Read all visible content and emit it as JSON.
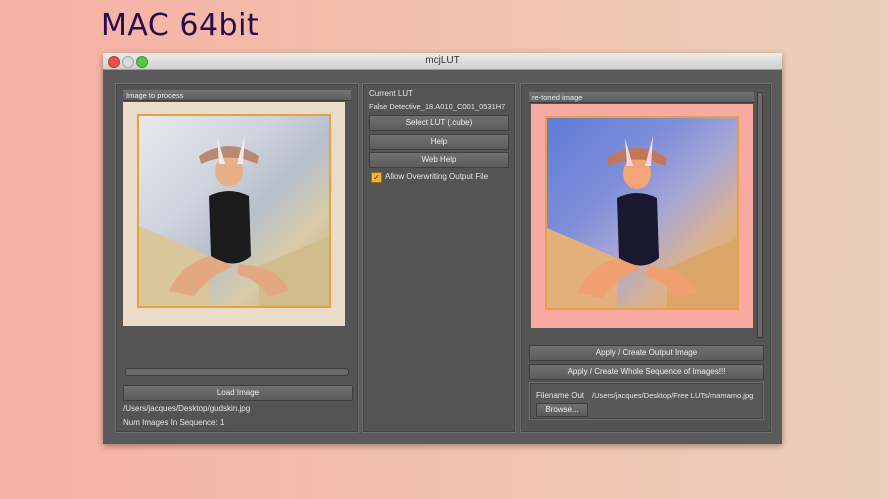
{
  "banner": "MAC 64bit",
  "window": {
    "title": "mcjLUT"
  },
  "left_panel": {
    "header": "Image to process",
    "load_button": "Load Image",
    "file_path": "/Users/jacques/Desktop/gudskin.jpg",
    "sequence_count": "Num Images In Sequence: 1"
  },
  "middle_panel": {
    "current_lut_label": "Current LUT",
    "current_lut_value": "False Detective_18.A010_C001_0531H7",
    "select_lut_button": "Select LUT (.cube)",
    "help_button": "Help",
    "web_help_button": "Web Help",
    "allow_overwrite_label": "Allow Overwriting Output File",
    "allow_overwrite_checked": true
  },
  "right_panel": {
    "header": "re-toned image",
    "apply_button": "Apply / Create Output Image",
    "apply_sequence_button": "Apply / Create Whole Sequence of Images!!!",
    "filename_out_label": "Filename Out",
    "filename_out_value": "/Users/jacques/Desktop/Free LUTs/mamamo.jpg",
    "browse_button": "Browse..."
  },
  "colors": {
    "window_bg": "#5a5a5a",
    "frame_accent": "#e5a13f",
    "retoned_bg": "#f7a9a2"
  }
}
